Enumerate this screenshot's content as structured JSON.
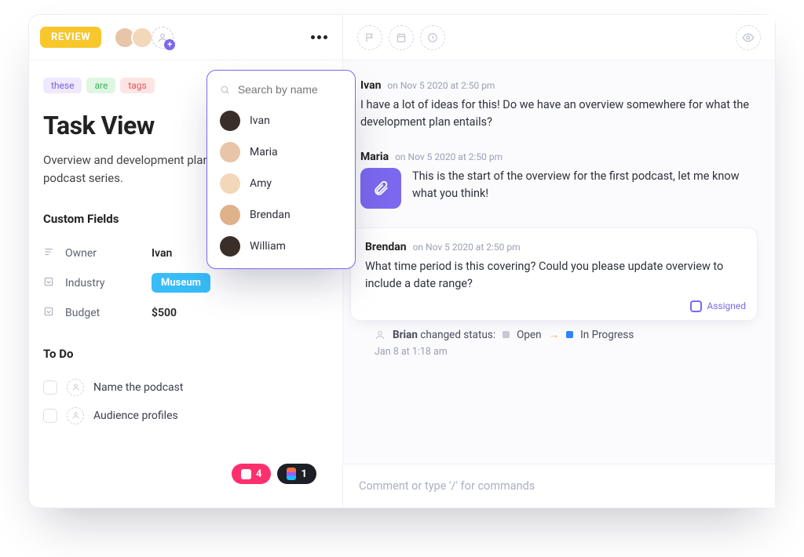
{
  "header": {
    "status_badge": "REVIEW"
  },
  "tags": [
    "these",
    "are",
    "tags"
  ],
  "task": {
    "title": "Task View",
    "description": "Overview and development planning of our original podcast series."
  },
  "custom_fields": {
    "label": "Custom Fields",
    "rows": [
      {
        "name": "Owner",
        "value": "Ivan"
      },
      {
        "name": "Industry",
        "value": "Museum"
      },
      {
        "name": "Budget",
        "value": "$500"
      }
    ]
  },
  "todo": {
    "label": "To Do",
    "items": [
      "Name the podcast",
      "Audience profiles"
    ]
  },
  "people_dropdown": {
    "placeholder": "Search by name",
    "items": [
      "Ivan",
      "Maria",
      "Amy",
      "Brendan",
      "William"
    ]
  },
  "comments": [
    {
      "author": "Ivan",
      "meta": "on Nov 5 2020 at 2:50 pm",
      "body": "I have a lot of ideas for this! Do we have an overview somewhere for what the development plan entails?"
    },
    {
      "author": "Maria",
      "meta": "on Nov 5 2020 at 2:50 pm",
      "body": "This is the start of the overview for the first podcast, let me know what you think!"
    },
    {
      "author": "Brendan",
      "meta": "on Nov 5 2020 at 2:50 pm",
      "body": "What time period is this covering? Could you please update overview to include a date range?",
      "assigned_label": "Assigned"
    }
  ],
  "status_change": {
    "actor": "Brian",
    "text": "changed status:",
    "from": "Open",
    "to": "In Progress",
    "timestamp": "Jan 8 at 1:18 am"
  },
  "compose": {
    "placeholder": "Comment or type '/' for commands"
  },
  "footer_pills": {
    "red_count": "4",
    "dark_count": "1"
  }
}
